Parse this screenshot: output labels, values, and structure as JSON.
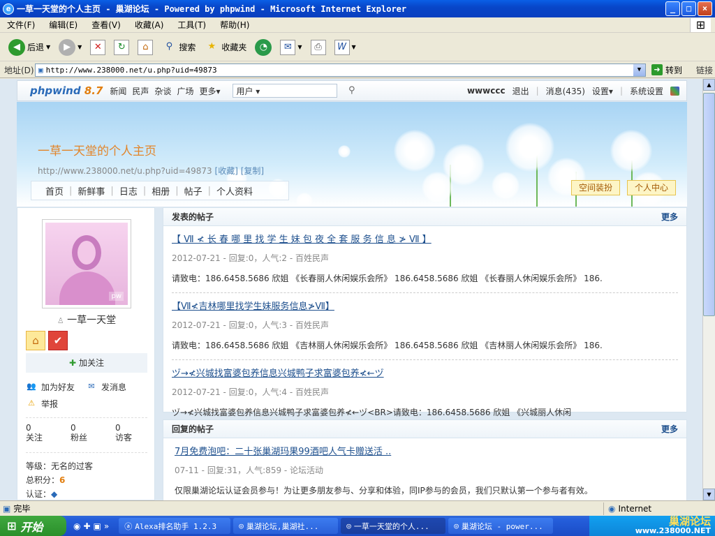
{
  "window": {
    "title": "一草一天堂的个人主页 - 巢湖论坛 - Powered by phpwind - Microsoft Internet Explorer",
    "buttons": [
      "_",
      "□",
      "×"
    ]
  },
  "menu": [
    "文件(F)",
    "编辑(E)",
    "查看(V)",
    "收藏(A)",
    "工具(T)",
    "帮助(H)"
  ],
  "toolbar": {
    "back_label": "后退",
    "search_label": "搜索",
    "favorites_label": "收藏夹",
    "icons": [
      "back-icon",
      "forward-icon",
      "stop-icon",
      "refresh-icon",
      "home-icon",
      "search-icon",
      "favorites-icon",
      "history-icon",
      "mail-icon",
      "print-icon",
      "edit-icon"
    ]
  },
  "address": {
    "label": "地址(D)",
    "url": "http://www.238000.net/u.php?uid=49873",
    "go": "转到",
    "links": "链接"
  },
  "site": {
    "logo_main": "phpwind",
    "logo_ver": "8.7",
    "nav": [
      "新闻",
      "民声",
      "杂谈",
      "广场",
      "更多▾"
    ],
    "search_scope": "用户 ▾",
    "username": "wwwccc",
    "logout": "退出",
    "messages": "消息(435)",
    "settings": "设置▾",
    "sys_settings": "系统设置"
  },
  "banner": {
    "title": "一草一天堂的个人主页",
    "url": "http://www.238000.net/u.php?uid=49873",
    "collect": "[收藏]",
    "copy": "[复制]",
    "nav": [
      "首页",
      "新鲜事",
      "日志",
      "相册",
      "帖子",
      "个人资料"
    ],
    "decor_btn": "空间装扮",
    "center_btn": "个人中心"
  },
  "profile": {
    "avatar_mark": "pw",
    "name": "一草一天堂",
    "follow": "加关注",
    "add_friend": "加为好友",
    "send_msg": "发消息",
    "report": "举报",
    "stats": [
      {
        "value": "0",
        "label": "关注"
      },
      {
        "value": "0",
        "label": "粉丝"
      },
      {
        "value": "0",
        "label": "访客"
      }
    ],
    "level_label": "等级：",
    "level_value": "无名的过客",
    "points_label": "总积分：",
    "points_value": "6",
    "auth_label": "认证："
  },
  "posts_panel": {
    "title": "发表的帖子",
    "more": "更多",
    "items": [
      {
        "title": "【 Ⅶ ≮ 长 春 哪 里 找 学 生 妹 包 夜 全 套 服 务 信 息 ≯ Ⅶ 】",
        "meta": "2012-07-21 - 回复:0，人气:2 - 百姓民声",
        "content": "请致电：186.6458.5686 欣姐 《长春丽人休闲娱乐会所》 186.6458.5686 欣姐 《长春丽人休闲娱乐会所》 186."
      },
      {
        "title": "【Ⅶ≮吉林哪里找学生妹服务信息≯Ⅶ】",
        "meta": "2012-07-21 - 回复:0，人气:3 - 百姓民声",
        "content": "请致电：186.6458.5686 欣姐 《吉林丽人休闲娱乐会所》 186.6458.5686 欣姐 《吉林丽人休闲娱乐会所》 186."
      },
      {
        "title": "ヅ→≮兴城找富婆包养信息兴城鸭子求富婆包养≮←ヅ",
        "meta": "2012-07-21 - 回复:0，人气:4 - 百姓民声",
        "content": "ヅ→≮兴城找富婆包养信息兴城鸭子求富婆包养≮←ヅ<BR>请致电：186.6458.5686 欣姐 《兴城丽人休闲"
      }
    ]
  },
  "replies_panel": {
    "title": "回复的帖子",
    "more": "更多",
    "items": [
      {
        "title": "7月免费泡吧：二十张巢湖玛果99酒吧人气卡赠送活 ..",
        "meta": "07-11 - 回复:31，人气:859 - 论坛活动",
        "content": "仅限巢湖论坛认证会员参与！为让更多朋友参与、分享和体验，同IP参与的会员，我们只默认第一个参与者有效。"
      }
    ]
  },
  "status": {
    "text": "完毕",
    "zone": "Internet"
  },
  "taskbar": {
    "start": "开始",
    "tasks": [
      "Alexa排名助手 1.2.3",
      "巢湖论坛,巢湖社...",
      "一草一天堂的个人...",
      "巢湖论坛 - power..."
    ],
    "tray_watermark": "巢湖论坛",
    "tray_url": "www.238000.NET"
  }
}
